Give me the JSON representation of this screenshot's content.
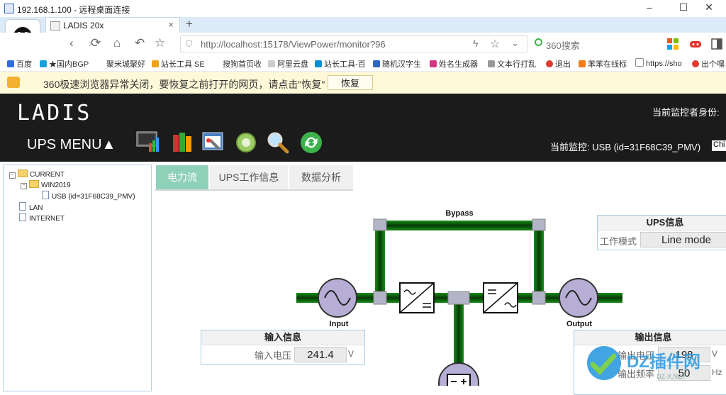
{
  "window": {
    "title": "192.168.1.100 - 远程桌面连接",
    "min": "–",
    "restore": "☐",
    "close": "✕"
  },
  "browser": {
    "tab": {
      "title": "LADIS 20x",
      "close": "×"
    },
    "new_tab": "+",
    "url": "http://localhost:15178/ViewPower/monitor?96",
    "search_placeholder": "360搜索",
    "bookmarks": [
      "百度",
      "★国内BGP",
      "聚米城聚好",
      "站长工具 SE",
      "搜狗首页收",
      "阿里云盘",
      "站长工具-百",
      "随机汉字生",
      "姓名生成器",
      "文本行打乱",
      "退出",
      "苯苯在线标",
      "https://sho",
      "出个嘿"
    ],
    "restore_message": "360极速浏览器异常关闭，要恢复之前打开的网页，请点击\"恢复\"",
    "restore_button": "恢复"
  },
  "app": {
    "logo": "LADIS",
    "menu": "UPS MENU▲",
    "monitor_identity_label": "当前监控者身份: ",
    "current_monitor": "当前监控: USB (id=31F68C39_PMV)",
    "language": "Chi"
  },
  "tree": {
    "current": "CURRENT",
    "host": "WIN2019",
    "device": "USB (id=31F68C39_PMV)",
    "lan": "LAN",
    "internet": "INTERNET"
  },
  "tabs": [
    "电力流",
    "UPS工作信息",
    "数据分析"
  ],
  "flow": {
    "bypass": "Bypass",
    "input": "Input",
    "output": "Output"
  },
  "ups_info": {
    "title": "UPS信息",
    "mode_label": "工作模式",
    "mode_value": "Line mode"
  },
  "input_info": {
    "title": "输入信息",
    "voltage_label": "输入电压",
    "voltage_value": "241.4",
    "voltage_unit": "V"
  },
  "output_info": {
    "title": "输出信息",
    "voltage_label": "输出电压",
    "voltage_value": "198",
    "voltage_unit": "V",
    "freq_label": "输出频率",
    "freq_value": "50",
    "freq_unit": "Hz"
  },
  "watermark": {
    "text": "DZ插件网",
    "sub": "DZ-X.NET"
  },
  "colors": {
    "flow_green": "#1a8c1a",
    "flow_dark": "#053b05",
    "tab_active": "#8fd0b9",
    "header_bg": "#1b1b1b"
  }
}
